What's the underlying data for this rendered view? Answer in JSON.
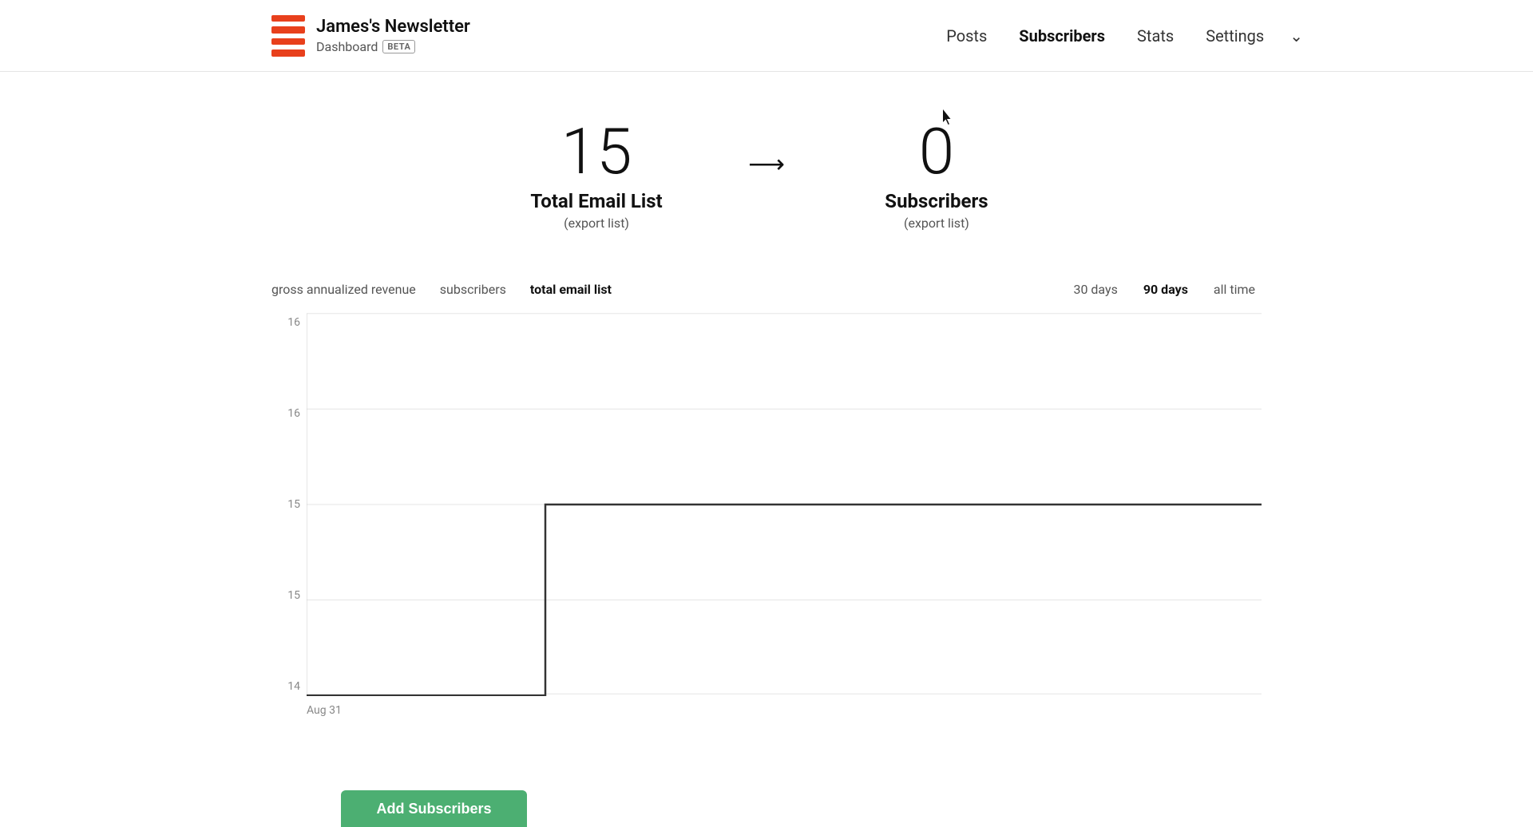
{
  "brand": {
    "name": "James's Newsletter",
    "sub": "Dashboard",
    "beta": "BETA"
  },
  "nav": {
    "items": [
      {
        "id": "posts",
        "label": "Posts",
        "active": false
      },
      {
        "id": "subscribers",
        "label": "Subscribers",
        "active": true
      },
      {
        "id": "stats",
        "label": "Stats",
        "active": false
      },
      {
        "id": "settings",
        "label": "Settings",
        "active": false
      }
    ]
  },
  "stats": {
    "left": {
      "number": "15",
      "label": "Total Email List",
      "sub": "(export list)"
    },
    "right": {
      "number": "0",
      "label": "Subscribers",
      "sub": "(export list)"
    }
  },
  "chart": {
    "tabs": [
      {
        "id": "revenue",
        "label": "gross annualized revenue",
        "active": false
      },
      {
        "id": "subscribers",
        "label": "subscribers",
        "active": false
      },
      {
        "id": "total-email-list",
        "label": "total email list",
        "active": true
      }
    ],
    "time_filters": [
      {
        "id": "30days",
        "label": "30 days",
        "active": false
      },
      {
        "id": "90days",
        "label": "90 days",
        "active": true
      },
      {
        "id": "alltime",
        "label": "all time",
        "active": false
      }
    ],
    "y_labels": [
      "16",
      "16",
      "15",
      "15",
      "14"
    ],
    "x_labels": [
      "Aug 31"
    ],
    "line_data": [
      14,
      14,
      14,
      14,
      15,
      15,
      15,
      15,
      15,
      15,
      15,
      15,
      15,
      15,
      15,
      15
    ]
  },
  "buttons": {
    "add_subscribers": "Add Subscribers"
  }
}
